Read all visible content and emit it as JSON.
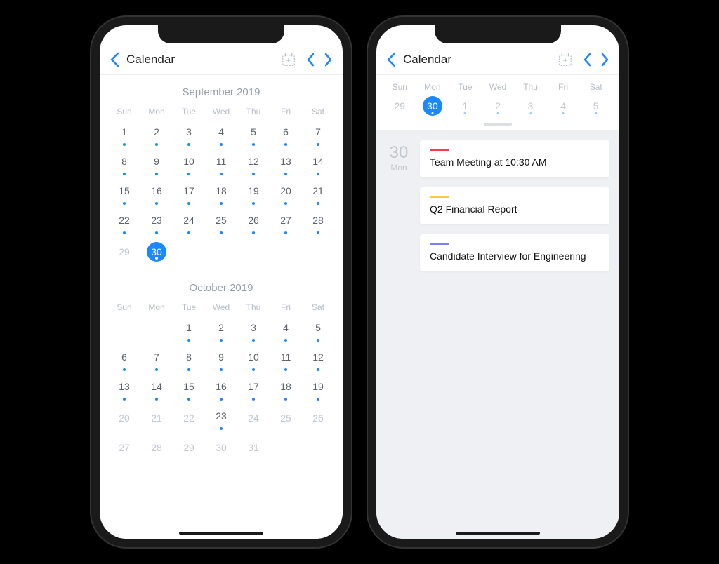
{
  "header": {
    "title": "Calendar"
  },
  "weekday_labels": [
    "Sun",
    "Mon",
    "Tue",
    "Wed",
    "Thu",
    "Fri",
    "Sat"
  ],
  "colors": {
    "accent": "#1b88ff",
    "event_pink": "#ff3657",
    "event_yellow": "#ffc93e",
    "event_purple": "#7c7cff"
  },
  "months": [
    {
      "title": "September 2019",
      "leading_empty": 0,
      "days": [
        {
          "n": 1,
          "dot": true
        },
        {
          "n": 2,
          "dot": true
        },
        {
          "n": 3,
          "dot": true
        },
        {
          "n": 4,
          "dot": true
        },
        {
          "n": 5,
          "dot": true
        },
        {
          "n": 6,
          "dot": true
        },
        {
          "n": 7,
          "dot": true
        },
        {
          "n": 8,
          "dot": true
        },
        {
          "n": 9,
          "dot": true
        },
        {
          "n": 10,
          "dot": true
        },
        {
          "n": 11,
          "dot": true
        },
        {
          "n": 12,
          "dot": true
        },
        {
          "n": 13,
          "dot": true
        },
        {
          "n": 14,
          "dot": true
        },
        {
          "n": 15,
          "dot": true
        },
        {
          "n": 16,
          "dot": true
        },
        {
          "n": 17,
          "dot": true
        },
        {
          "n": 18,
          "dot": true
        },
        {
          "n": 19,
          "dot": true
        },
        {
          "n": 20,
          "dot": true
        },
        {
          "n": 21,
          "dot": true
        },
        {
          "n": 22,
          "dot": true
        },
        {
          "n": 23,
          "dot": true
        },
        {
          "n": 24,
          "dot": true
        },
        {
          "n": 25,
          "dot": true
        },
        {
          "n": 26,
          "dot": true
        },
        {
          "n": 27,
          "dot": true
        },
        {
          "n": 28,
          "dot": true
        },
        {
          "n": 29,
          "dot": false,
          "dim": true
        },
        {
          "n": 30,
          "dot": true,
          "selected": true
        }
      ]
    },
    {
      "title": "October 2019",
      "leading_empty": 2,
      "days": [
        {
          "n": 1,
          "dot": true
        },
        {
          "n": 2,
          "dot": true
        },
        {
          "n": 3,
          "dot": true
        },
        {
          "n": 4,
          "dot": true
        },
        {
          "n": 5,
          "dot": true
        },
        {
          "n": 6,
          "dot": true
        },
        {
          "n": 7,
          "dot": true
        },
        {
          "n": 8,
          "dot": true
        },
        {
          "n": 9,
          "dot": true
        },
        {
          "n": 10,
          "dot": true
        },
        {
          "n": 11,
          "dot": true
        },
        {
          "n": 12,
          "dot": true
        },
        {
          "n": 13,
          "dot": true
        },
        {
          "n": 14,
          "dot": true
        },
        {
          "n": 15,
          "dot": true
        },
        {
          "n": 16,
          "dot": true
        },
        {
          "n": 17,
          "dot": true
        },
        {
          "n": 18,
          "dot": true
        },
        {
          "n": 19,
          "dot": true
        },
        {
          "n": 20,
          "dot": false,
          "dim": true
        },
        {
          "n": 21,
          "dot": false,
          "dim": true
        },
        {
          "n": 22,
          "dot": false,
          "dim": true
        },
        {
          "n": 23,
          "dot": true
        },
        {
          "n": 24,
          "dot": false,
          "dim": true
        },
        {
          "n": 25,
          "dot": false,
          "dim": true
        },
        {
          "n": 26,
          "dot": false,
          "dim": true
        },
        {
          "n": 27,
          "dot": false,
          "dim": true
        },
        {
          "n": 28,
          "dot": false,
          "dim": true
        },
        {
          "n": 29,
          "dot": false,
          "dim": true
        },
        {
          "n": 30,
          "dot": false,
          "dim": true
        },
        {
          "n": 31,
          "dot": false,
          "dim": true
        }
      ]
    }
  ],
  "week_strip": {
    "days": [
      {
        "label": "Sun",
        "n": 29,
        "dot": false
      },
      {
        "label": "Mon",
        "n": 30,
        "dot": true,
        "selected": true
      },
      {
        "label": "Tue",
        "n": 1,
        "dot": true
      },
      {
        "label": "Wed",
        "n": 2,
        "dot": true
      },
      {
        "label": "Thu",
        "n": 3,
        "dot": true
      },
      {
        "label": "Fri",
        "n": 4,
        "dot": true
      },
      {
        "label": "Sat",
        "n": 5,
        "dot": true
      }
    ]
  },
  "agenda": {
    "date_num": "30",
    "date_dow": "Mon",
    "events": [
      {
        "color": "event_pink",
        "text": "Team Meeting at 10:30 AM"
      },
      {
        "color": "event_yellow",
        "text": "Q2 Financial Report"
      },
      {
        "color": "event_purple",
        "text": "Candidate Interview for Engineering"
      }
    ]
  }
}
